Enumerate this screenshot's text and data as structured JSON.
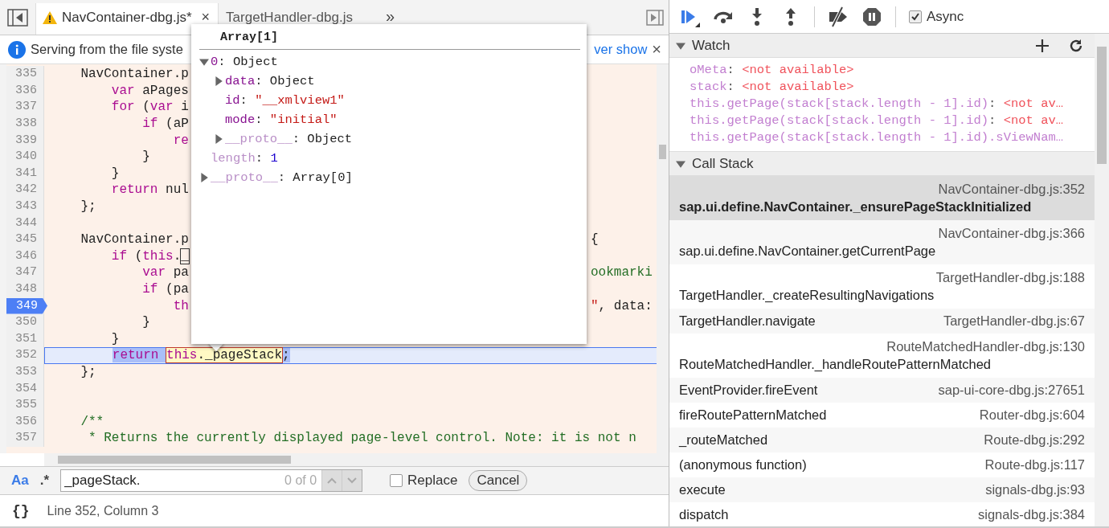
{
  "editor": {
    "tabs": [
      {
        "label": "NavContainer-dbg.js*",
        "selected": true,
        "warning": true,
        "close": "×"
      },
      {
        "label": "TargetHandler-dbg.js",
        "selected": false,
        "warning": false
      }
    ],
    "overflow": "»",
    "infobar": {
      "message": "Serving from the file syste",
      "link": "ver show",
      "close": "×"
    },
    "lines": [
      {
        "number": "335",
        "breakpoint": false,
        "current": false,
        "left": [
          {
            "kind": "plain",
            "text": "    NavContainer.p"
          }
        ]
      },
      {
        "number": "336",
        "breakpoint": false,
        "current": false,
        "left": [
          {
            "kind": "keyword",
            "text": "        var"
          },
          {
            "kind": "plain",
            "text": " aPages"
          }
        ]
      },
      {
        "number": "337",
        "breakpoint": false,
        "current": false,
        "left": [
          {
            "kind": "keyword",
            "text": "        for"
          },
          {
            "kind": "plain",
            "text": " ("
          },
          {
            "kind": "keyword",
            "text": "var"
          },
          {
            "kind": "plain",
            "text": " i"
          }
        ]
      },
      {
        "number": "338",
        "breakpoint": false,
        "current": false,
        "left": [
          {
            "kind": "keyword",
            "text": "            if"
          },
          {
            "kind": "plain",
            "text": " (aP"
          }
        ]
      },
      {
        "number": "339",
        "breakpoint": false,
        "current": false,
        "left": [
          {
            "kind": "keyword",
            "text": "                re"
          }
        ]
      },
      {
        "number": "340",
        "breakpoint": false,
        "current": false,
        "left": [
          {
            "kind": "plain",
            "text": "            }"
          }
        ]
      },
      {
        "number": "341",
        "breakpoint": false,
        "current": false,
        "left": [
          {
            "kind": "plain",
            "text": "        }"
          }
        ]
      },
      {
        "number": "342",
        "breakpoint": false,
        "current": false,
        "left": [
          {
            "kind": "keyword",
            "text": "        return"
          },
          {
            "kind": "plain",
            "text": " nul"
          }
        ]
      },
      {
        "number": "343",
        "breakpoint": false,
        "current": false,
        "left": [
          {
            "kind": "plain",
            "text": "    };"
          }
        ]
      },
      {
        "number": "344",
        "breakpoint": false,
        "current": false
      },
      {
        "number": "345",
        "breakpoint": false,
        "current": false,
        "left": [
          {
            "kind": "plain",
            "text": "    NavContainer.p"
          }
        ],
        "right": [
          {
            "kind": "plain",
            "text": "{"
          }
        ]
      },
      {
        "number": "346",
        "breakpoint": false,
        "current": false,
        "left": [
          {
            "kind": "keyword",
            "text": "        if"
          },
          {
            "kind": "plain",
            "text": " ("
          },
          {
            "kind": "keyword",
            "text": "this"
          },
          {
            "kind": "plain",
            "text": "."
          },
          {
            "kind": "plain",
            "text": "_",
            "match": true
          }
        ]
      },
      {
        "number": "347",
        "breakpoint": false,
        "current": false,
        "left": [
          {
            "kind": "keyword",
            "text": "            var"
          },
          {
            "kind": "plain",
            "text": " pa"
          }
        ],
        "right": [
          {
            "kind": "comment",
            "text": "ookmarki"
          }
        ]
      },
      {
        "number": "348",
        "breakpoint": false,
        "current": false,
        "left": [
          {
            "kind": "keyword",
            "text": "            if"
          },
          {
            "kind": "plain",
            "text": " (pa"
          }
        ]
      },
      {
        "number": "349",
        "breakpoint": true,
        "current": false,
        "left": [
          {
            "kind": "keyword",
            "text": "                th"
          }
        ],
        "right": [
          {
            "kind": "string",
            "text": "\""
          },
          {
            "kind": "plain",
            "text": ", data:"
          }
        ]
      },
      {
        "number": "350",
        "breakpoint": false,
        "current": false,
        "left": [
          {
            "kind": "plain",
            "text": "            }"
          }
        ]
      },
      {
        "number": "351",
        "breakpoint": false,
        "current": false,
        "left": [
          {
            "kind": "plain",
            "text": "        }"
          }
        ]
      },
      {
        "number": "352",
        "breakpoint": false,
        "current": true,
        "left": [
          {
            "kind": "keyword",
            "text": "        return ",
            "selected": true
          },
          {
            "hovered": true,
            "tokens": [
              {
                "kind": "keyword",
                "text": "this"
              },
              {
                "kind": "plain",
                "text": "._pageStack"
              }
            ]
          },
          {
            "kind": "plain",
            "text": ";",
            "selected": true
          }
        ]
      },
      {
        "number": "353",
        "breakpoint": false,
        "current": false,
        "left": [
          {
            "kind": "plain",
            "text": "    };"
          }
        ]
      },
      {
        "number": "354",
        "breakpoint": false,
        "current": false
      },
      {
        "number": "355",
        "breakpoint": false,
        "current": false
      },
      {
        "number": "356",
        "breakpoint": false,
        "current": false,
        "left": [
          {
            "kind": "comment",
            "text": "    /**"
          }
        ]
      },
      {
        "number": "357",
        "breakpoint": false,
        "current": false,
        "left": [
          {
            "kind": "comment",
            "text": "     * Returns the currently displayed page-level control. Note: it is not n"
          }
        ]
      }
    ],
    "popup": {
      "title": "Array[1]",
      "nodes": [
        {
          "kind": "branch",
          "expanded": true,
          "name": "0",
          "sep": ":",
          "value": "Object",
          "color": "#222222",
          "dimmed": false,
          "children": [
            {
              "kind": "branch",
              "expanded": false,
              "name": "data",
              "sep": ":",
              "value": "Object",
              "color": "#222222",
              "dimmed": false
            },
            {
              "kind": "leaf",
              "name": "id",
              "sep": ":",
              "value": "\"__xmlview1\"",
              "color": "#c41a16",
              "dimmed": false
            },
            {
              "kind": "leaf",
              "name": "mode",
              "sep": ":",
              "value": "\"initial\"",
              "color": "#c41a16",
              "dimmed": false
            },
            {
              "kind": "branch",
              "expanded": false,
              "name": "__proto__",
              "sep": ":",
              "value": "Object",
              "color": "#222222",
              "dimmed": true
            }
          ]
        },
        {
          "kind": "leaf",
          "name": "length",
          "sep": ":",
          "value": "1",
          "color": "#1c00cf",
          "dimmed": true
        },
        {
          "kind": "branch",
          "expanded": false,
          "name": "__proto__",
          "sep": ":",
          "value": "Array[0]",
          "color": "#222222",
          "dimmed": true
        }
      ]
    },
    "search": {
      "case": {
        "label": "Aa",
        "on": true
      },
      "regex": {
        "label": ".*",
        "on": false
      },
      "query": "_pageStack.",
      "count": "0 of 0",
      "replace": {
        "label": "Replace",
        "checked": false
      },
      "cancel": "Cancel"
    },
    "status": {
      "format": "{}",
      "position": "Line 352, Column 3"
    }
  },
  "debugger": {
    "toolbar": [
      {
        "kind": "resume"
      },
      {
        "kind": "step-over"
      },
      {
        "kind": "step-into"
      },
      {
        "kind": "step-out"
      },
      {
        "kind": "separator"
      },
      {
        "kind": "deactivate"
      },
      {
        "kind": "pause-exceptions"
      },
      {
        "kind": "separator"
      }
    ],
    "async": {
      "label": "Async",
      "checked": true
    },
    "watch": {
      "title": "Watch",
      "expanded": true,
      "entries": [
        {
          "name": "oMeta",
          "sep": ":",
          "value": "<not available>"
        },
        {
          "name": "stack",
          "sep": ":",
          "value": "<not available>"
        },
        {
          "name": "this.getPage(stack[stack.length - 1].id)",
          "sep": ":",
          "value": "<not av…"
        },
        {
          "name": "this.getPage(stack[stack.length - 1].id)",
          "sep": ":",
          "value": "<not av…"
        },
        {
          "name": "this.getPage(stack[stack.length - 1].id).sViewNam…"
        }
      ]
    },
    "callstack": {
      "title": "Call Stack",
      "expanded": true,
      "frames": [
        {
          "kind": "wrapped",
          "selected": true,
          "function": "sap.ui.define.NavContainer._ensurePageStackInitialized",
          "location": "NavContainer-dbg.js:352"
        },
        {
          "kind": "wrapped",
          "selected": false,
          "function": "sap.ui.define.NavContainer.getCurrentPage",
          "location": "NavContainer-dbg.js:366"
        },
        {
          "kind": "wrapped",
          "selected": false,
          "function": "TargetHandler._createResultingNavigations",
          "location": "TargetHandler-dbg.js:188"
        },
        {
          "kind": "inline",
          "selected": false,
          "function": "TargetHandler.navigate",
          "location": "TargetHandler-dbg.js:67"
        },
        {
          "kind": "wrapped",
          "selected": false,
          "function": "RouteMatchedHandler._handleRoutePatternMatched",
          "location": "RouteMatchedHandler-dbg.js:130"
        },
        {
          "kind": "inline",
          "selected": false,
          "function": "EventProvider.fireEvent",
          "location": "sap-ui-core-dbg.js:27651"
        },
        {
          "kind": "inline",
          "selected": false,
          "function": "fireRoutePatternMatched",
          "location": "Router-dbg.js:604"
        },
        {
          "kind": "inline",
          "selected": false,
          "function": "_routeMatched",
          "location": "Route-dbg.js:292"
        },
        {
          "kind": "inline",
          "selected": false,
          "function": "(anonymous function)",
          "location": "Route-dbg.js:117"
        },
        {
          "kind": "inline",
          "selected": false,
          "function": "execute",
          "location": "signals-dbg.js:93"
        },
        {
          "kind": "inline",
          "selected": false,
          "function": "dispatch",
          "location": "signals-dbg.js:384"
        }
      ]
    }
  }
}
